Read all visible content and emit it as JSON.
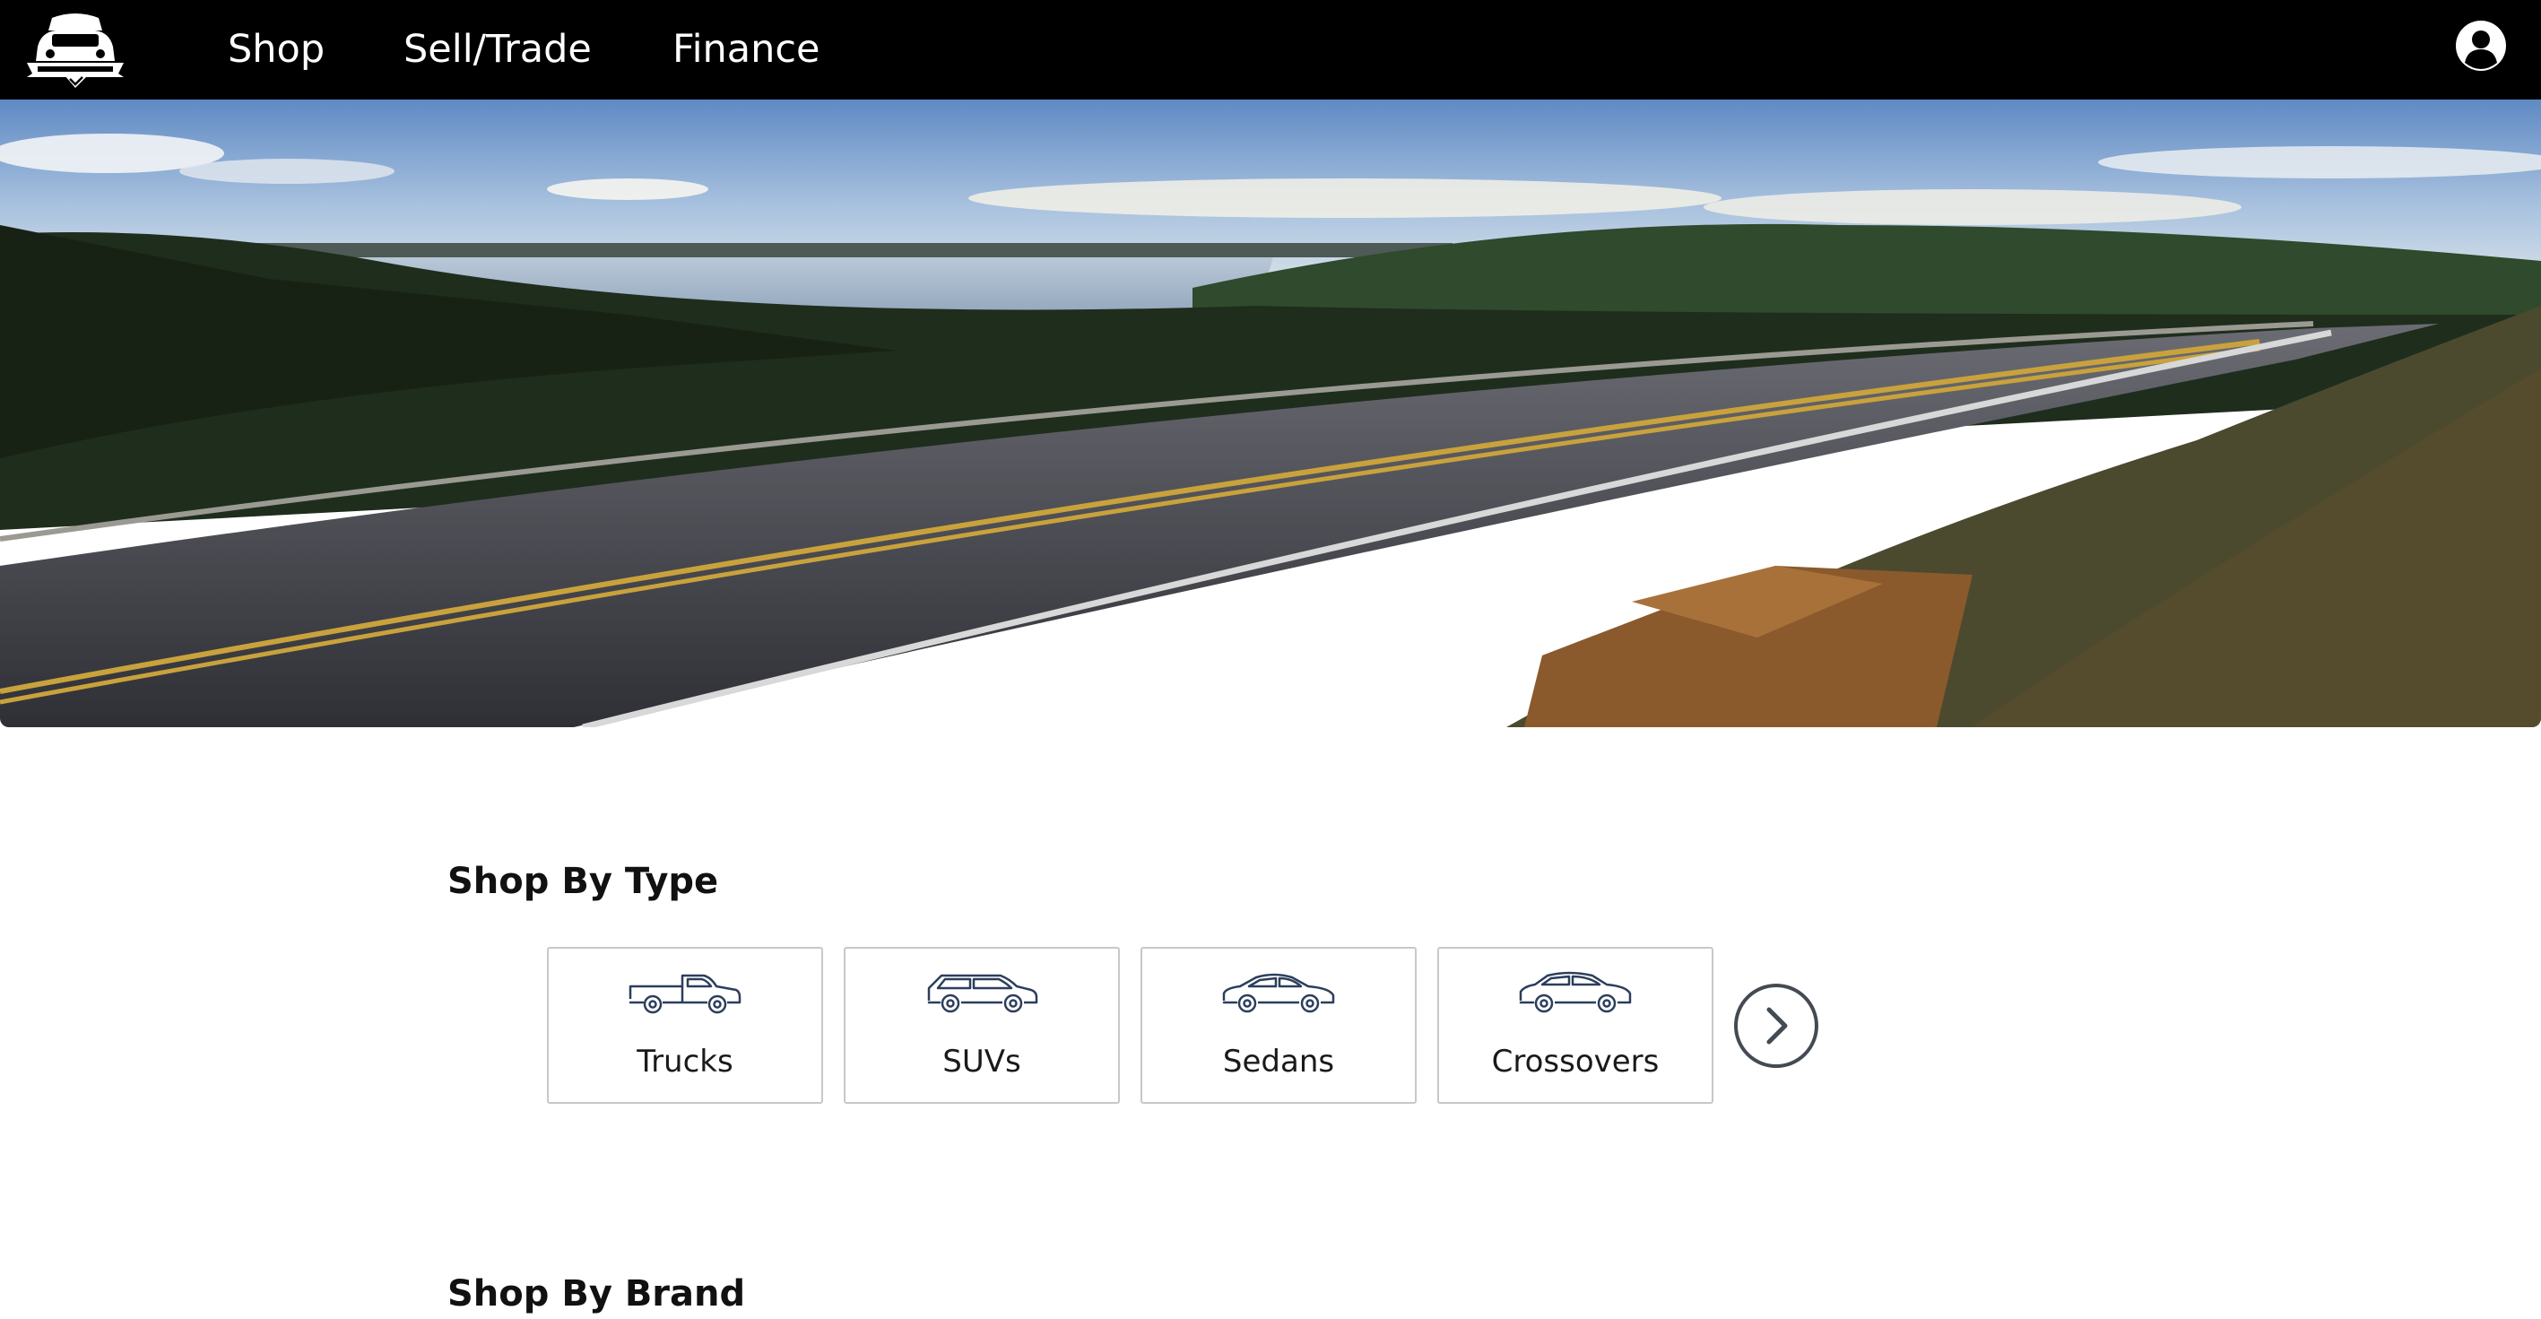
{
  "nav": {
    "logo_icon": "car-shield-logo-icon",
    "items": [
      {
        "label": "Shop"
      },
      {
        "label": "Sell/Trade"
      },
      {
        "label": "Finance"
      }
    ],
    "account_icon": "user-account-icon"
  },
  "hero": {
    "image": "scenic-road-lake-landscape"
  },
  "shop_by_type": {
    "title": "Shop By Type",
    "types": [
      {
        "label": "Trucks",
        "icon": "truck-icon"
      },
      {
        "label": "SUVs",
        "icon": "suv-icon"
      },
      {
        "label": "Sedans",
        "icon": "sedan-icon"
      },
      {
        "label": "Crossovers",
        "icon": "crossover-icon"
      }
    ],
    "next_icon": "chevron-right-icon"
  },
  "shop_by_brand": {
    "title": "Shop By Brand"
  },
  "colors": {
    "header_bg": "#000000",
    "icon_stroke": "#2c3e5c",
    "card_border": "#c8c8c8"
  }
}
